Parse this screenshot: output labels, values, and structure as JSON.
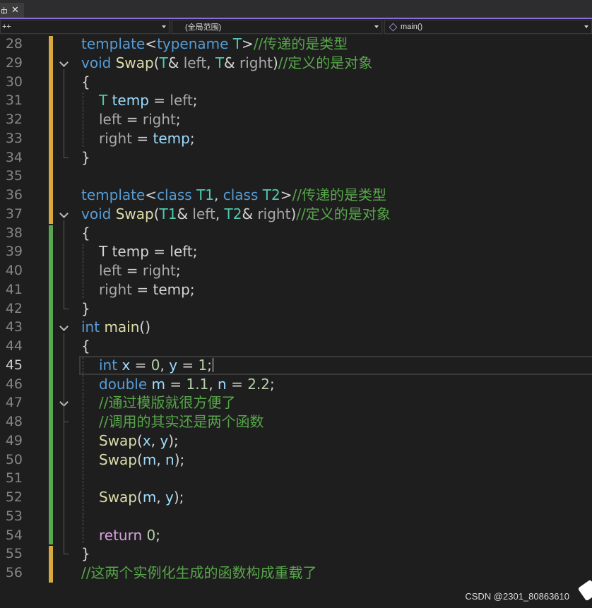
{
  "tab": {
    "pin_icon": "pin-icon",
    "close_icon": "close-icon",
    "close_glyph": "✕"
  },
  "navbar": {
    "project_value": "++",
    "scope_value": "(全局范围)",
    "member_value": "main()",
    "member_icon": "cube-icon"
  },
  "editor": {
    "current_line": 45,
    "lines": [
      {
        "no": "28",
        "tokens": [
          [
            "kw",
            "template"
          ],
          [
            "pl",
            "<"
          ],
          [
            "kw",
            "typename"
          ],
          [
            "pl",
            " "
          ],
          [
            "ty",
            "T"
          ],
          [
            "pl",
            ">"
          ],
          [
            "cm",
            "//传递的是类型"
          ]
        ]
      },
      {
        "no": "29",
        "tokens": [
          [
            "kw",
            "void"
          ],
          [
            "pl",
            " "
          ],
          [
            "fn",
            "Swap"
          ],
          [
            "pl",
            "("
          ],
          [
            "ty",
            "T"
          ],
          [
            "pl",
            "& "
          ],
          [
            "dim",
            "left"
          ],
          [
            "pl",
            ", "
          ],
          [
            "ty",
            "T"
          ],
          [
            "pl",
            "& "
          ],
          [
            "dim",
            "right"
          ],
          [
            "pl",
            ")"
          ],
          [
            "cm",
            "//定义的是对象"
          ]
        ]
      },
      {
        "no": "30",
        "tokens": [
          [
            "pl",
            "{"
          ]
        ]
      },
      {
        "no": "31",
        "tokens": [
          [
            "ty",
            "T"
          ],
          [
            "pl",
            " "
          ],
          [
            "var",
            "temp"
          ],
          [
            "pl",
            " = "
          ],
          [
            "dim",
            "left"
          ],
          [
            "pl",
            ";"
          ]
        ]
      },
      {
        "no": "32",
        "tokens": [
          [
            "dim",
            "left"
          ],
          [
            "pl",
            " = "
          ],
          [
            "dim",
            "right"
          ],
          [
            "pl",
            ";"
          ]
        ]
      },
      {
        "no": "33",
        "tokens": [
          [
            "dim",
            "right"
          ],
          [
            "pl",
            " = "
          ],
          [
            "var",
            "temp"
          ],
          [
            "pl",
            ";"
          ]
        ]
      },
      {
        "no": "34",
        "tokens": [
          [
            "pl",
            "}"
          ]
        ]
      },
      {
        "no": "35",
        "tokens": []
      },
      {
        "no": "36",
        "tokens": [
          [
            "kw",
            "template"
          ],
          [
            "pl",
            "<"
          ],
          [
            "kw",
            "class"
          ],
          [
            "pl",
            " "
          ],
          [
            "ty",
            "T1"
          ],
          [
            "pl",
            ", "
          ],
          [
            "kw",
            "class"
          ],
          [
            "pl",
            " "
          ],
          [
            "ty",
            "T2"
          ],
          [
            "pl",
            ">"
          ],
          [
            "cm",
            "//传递的是类型"
          ]
        ]
      },
      {
        "no": "37",
        "tokens": [
          [
            "kw",
            "void"
          ],
          [
            "pl",
            " "
          ],
          [
            "fn",
            "Swap"
          ],
          [
            "pl",
            "("
          ],
          [
            "ty",
            "T1"
          ],
          [
            "pl",
            "& "
          ],
          [
            "dim",
            "left"
          ],
          [
            "pl",
            ", "
          ],
          [
            "ty",
            "T2"
          ],
          [
            "pl",
            "& "
          ],
          [
            "dim",
            "right"
          ],
          [
            "pl",
            ")"
          ],
          [
            "cm",
            "//定义的是对象"
          ]
        ]
      },
      {
        "no": "38",
        "tokens": [
          [
            "pl",
            "{"
          ]
        ]
      },
      {
        "no": "39",
        "tokens": [
          [
            "pl",
            "T temp = left;"
          ]
        ]
      },
      {
        "no": "40",
        "tokens": [
          [
            "dim",
            "left"
          ],
          [
            "pl",
            " = "
          ],
          [
            "dim",
            "right"
          ],
          [
            "pl",
            ";"
          ]
        ]
      },
      {
        "no": "41",
        "tokens": [
          [
            "dim",
            "right"
          ],
          [
            "pl",
            " = "
          ],
          [
            "pl",
            "temp"
          ],
          [
            "pl",
            ";"
          ]
        ]
      },
      {
        "no": "42",
        "tokens": [
          [
            "pl",
            "}"
          ]
        ]
      },
      {
        "no": "43",
        "tokens": [
          [
            "kw",
            "int"
          ],
          [
            "pl",
            " "
          ],
          [
            "fn",
            "main"
          ],
          [
            "pl",
            "()"
          ]
        ]
      },
      {
        "no": "44",
        "tokens": [
          [
            "pl",
            "{"
          ]
        ]
      },
      {
        "no": "45",
        "tokens": [
          [
            "kw",
            "int"
          ],
          [
            "pl",
            " "
          ],
          [
            "var",
            "x"
          ],
          [
            "pl",
            " = "
          ],
          [
            "num",
            "0"
          ],
          [
            "pl",
            ", "
          ],
          [
            "var",
            "y"
          ],
          [
            "pl",
            " = "
          ],
          [
            "num",
            "1"
          ],
          [
            "pl",
            ";"
          ]
        ]
      },
      {
        "no": "46",
        "tokens": [
          [
            "kw",
            "double"
          ],
          [
            "pl",
            " "
          ],
          [
            "var",
            "m"
          ],
          [
            "pl",
            " = "
          ],
          [
            "num",
            "1.1"
          ],
          [
            "pl",
            ", "
          ],
          [
            "var",
            "n"
          ],
          [
            "pl",
            " = "
          ],
          [
            "num",
            "2.2"
          ],
          [
            "pl",
            ";"
          ]
        ]
      },
      {
        "no": "47",
        "tokens": [
          [
            "cm",
            "//通过模版就很方便了"
          ]
        ]
      },
      {
        "no": "48",
        "tokens": [
          [
            "cm",
            "//调用的其实还是两个函数"
          ]
        ]
      },
      {
        "no": "49",
        "tokens": [
          [
            "fn",
            "Swap"
          ],
          [
            "pl",
            "("
          ],
          [
            "var",
            "x"
          ],
          [
            "pl",
            ", "
          ],
          [
            "var",
            "y"
          ],
          [
            "pl",
            ");"
          ]
        ]
      },
      {
        "no": "50",
        "tokens": [
          [
            "fn",
            "Swap"
          ],
          [
            "pl",
            "("
          ],
          [
            "var",
            "m"
          ],
          [
            "pl",
            ", "
          ],
          [
            "var",
            "n"
          ],
          [
            "pl",
            ");"
          ]
        ]
      },
      {
        "no": "51",
        "tokens": []
      },
      {
        "no": "52",
        "tokens": [
          [
            "fn",
            "Swap"
          ],
          [
            "pl",
            "("
          ],
          [
            "var",
            "m"
          ],
          [
            "pl",
            ", "
          ],
          [
            "var",
            "y"
          ],
          [
            "pl",
            ");"
          ]
        ]
      },
      {
        "no": "53",
        "tokens": []
      },
      {
        "no": "54",
        "tokens": [
          [
            "ret",
            "return"
          ],
          [
            "pl",
            " "
          ],
          [
            "num",
            "0"
          ],
          [
            "pl",
            ";"
          ]
        ]
      },
      {
        "no": "55",
        "tokens": [
          [
            "pl",
            "}"
          ]
        ]
      },
      {
        "no": "56",
        "tokens": [
          [
            "cm",
            "//这两个实例化生成的函数构成重载了"
          ]
        ]
      }
    ]
  },
  "colors": {
    "keyword": "#569cd6",
    "type": "#4ec9b0",
    "function": "#dcdcaa",
    "variable": "#9cdcfe",
    "comment": "#57a64a",
    "number": "#b5cea8",
    "control": "#d8a0df",
    "change_saved": "#58a84f",
    "change_unsaved": "#d7a93e",
    "tab_accent": "#8a6fd6"
  },
  "watermark": "CSDN @2301_80863610"
}
